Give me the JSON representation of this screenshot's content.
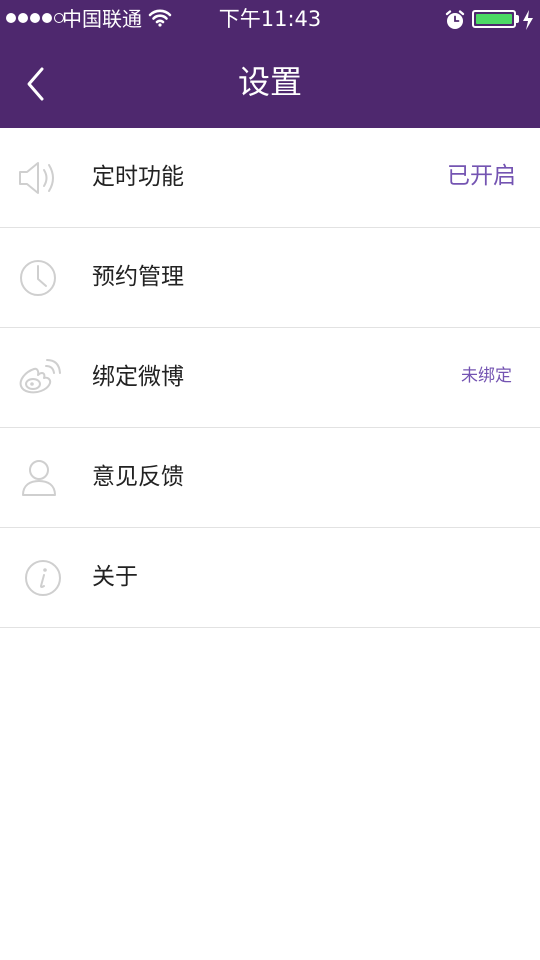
{
  "status_bar": {
    "carrier": "中国联通",
    "time": "下午11:43",
    "battery_level": 1.0
  },
  "header": {
    "title": "设置"
  },
  "settings": {
    "items": [
      {
        "label": "定时功能",
        "value": "已开启",
        "icon": "speaker-icon"
      },
      {
        "label": "预约管理",
        "value": "",
        "icon": "clock-icon"
      },
      {
        "label": "绑定微博",
        "value": "未绑定",
        "icon": "weibo-icon"
      },
      {
        "label": "意见反馈",
        "value": "",
        "icon": "user-icon"
      },
      {
        "label": "关于",
        "value": "",
        "icon": "info-icon"
      }
    ]
  },
  "colors": {
    "header_bg": "#4e286e",
    "accent": "#7454b2",
    "battery": "#4cd964"
  }
}
